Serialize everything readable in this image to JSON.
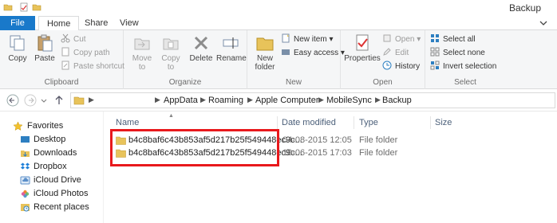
{
  "window": {
    "title": "Backup"
  },
  "tabs": [
    {
      "label": "File"
    },
    {
      "label": "Home"
    },
    {
      "label": "Share"
    },
    {
      "label": "View"
    }
  ],
  "ribbon": {
    "clipboard": {
      "label": "Clipboard",
      "copy": "Copy",
      "paste": "Paste",
      "cut": "Cut",
      "copy_path": "Copy path",
      "paste_shortcut": "Paste shortcut"
    },
    "organize": {
      "label": "Organize",
      "move_to": "Move to",
      "copy_to": "Copy to",
      "delete": "Delete",
      "rename": "Rename"
    },
    "new": {
      "label": "New",
      "new_folder_line1": "New",
      "new_folder_line2": "folder",
      "new_item": "New item",
      "easy_access": "Easy access"
    },
    "open": {
      "label": "Open",
      "properties": "Properties",
      "open": "Open",
      "edit": "Edit",
      "history": "History"
    },
    "select": {
      "label": "Select",
      "select_all": "Select all",
      "select_none": "Select none",
      "invert_selection": "Invert selection"
    }
  },
  "address": {
    "crumbs": [
      "AppData",
      "Roaming",
      "Apple Computer",
      "MobileSync",
      "Backup"
    ]
  },
  "navpane": {
    "favorites": "Favorites",
    "items": [
      {
        "label": "Desktop",
        "icon": "desktop-icon"
      },
      {
        "label": "Downloads",
        "icon": "downloads-icon"
      },
      {
        "label": "Dropbox",
        "icon": "dropbox-icon"
      },
      {
        "label": "iCloud Drive",
        "icon": "icloud-drive-icon"
      },
      {
        "label": "iCloud Photos",
        "icon": "icloud-photos-icon"
      },
      {
        "label": "Recent places",
        "icon": "recent-places-icon"
      }
    ]
  },
  "columns": {
    "name": "Name",
    "date": "Date modified",
    "type": "Type",
    "size": "Size"
  },
  "files": [
    {
      "name": "b4c8baf6c43b853af5d217b25f549448ec9c...",
      "date": "04-08-2015 12:05",
      "type": "File folder"
    },
    {
      "name": "b4c8baf6c43b853af5d217b25f549448ec9c...",
      "date": "10-06-2015 17:03",
      "type": "File folder"
    }
  ],
  "colors": {
    "file_tab": "#1979ca",
    "highlight": "#e8191c",
    "folder": "#e8c35a"
  }
}
